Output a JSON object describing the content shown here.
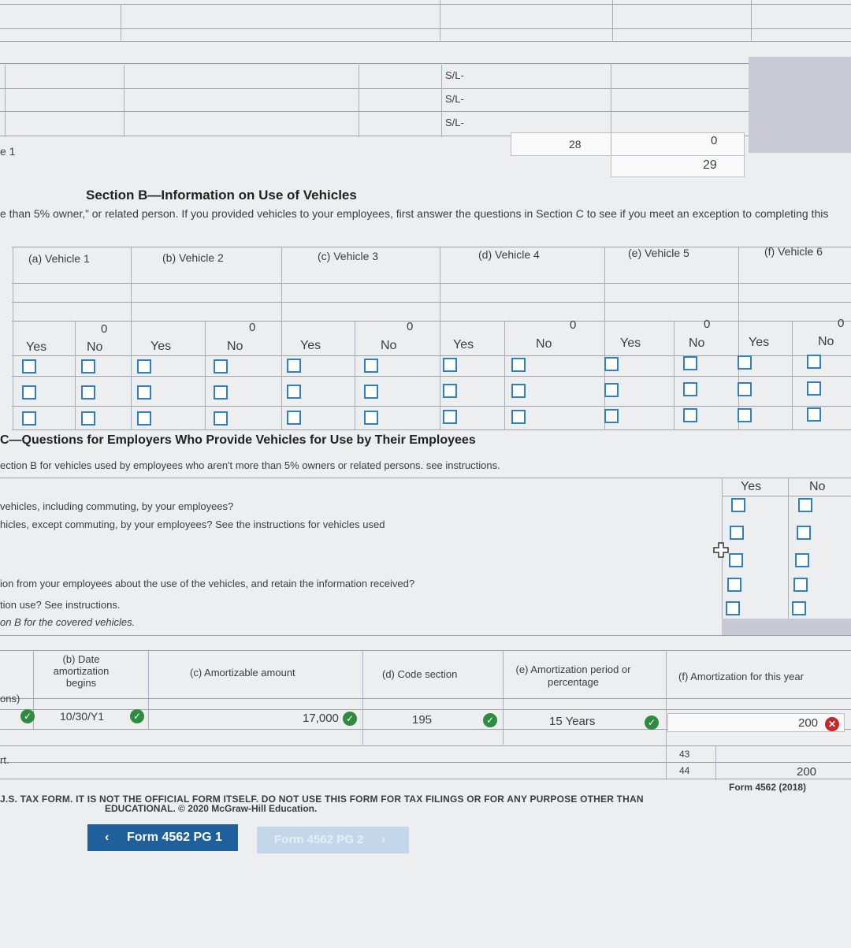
{
  "top_table": {
    "sl_labels": [
      "S/L-",
      "S/L-",
      "S/L-"
    ],
    "line_label": "e 1",
    "box28": "28",
    "box28_value": "0",
    "box29": "29"
  },
  "section_b": {
    "title": "Section B—Information on Use of Vehicles",
    "intro": "e than 5% owner,” or related person.  If you provided vehicles to your employees, first answer the questions in Section C to see if you meet an exception to completing this",
    "vehicles": [
      "(a) Vehicle 1",
      "(b) Vehicle 2",
      "(c) Vehicle 3",
      "(d) Vehicle 4",
      "(e) Vehicle 5",
      "(f) Vehicle 6"
    ],
    "totals": [
      "0",
      "0",
      "0",
      "0",
      "0",
      "0"
    ],
    "yes_label": "Yes",
    "no_label": "No"
  },
  "section_c": {
    "title": "C—Questions for Employers Who Provide Vehicles for Use by Their Employees",
    "intro": "ection B for vehicles used by employees who aren't more than 5% owners or related persons. see instructions.",
    "yes_label": "Yes",
    "no_label": "No",
    "questions": [
      "vehicles, including commuting, by your employees?",
      "hicles, except commuting, by your employees?  See the instructions for vehicles used",
      "ion from your employees about the use of the vehicles, and retain the information received?",
      "tion use?  See instructions.",
      "on B for the covered vehicles."
    ]
  },
  "amortization": {
    "col_b": "(b) Date amortization begins",
    "col_c": "(c) Amortizable amount",
    "col_d": "(d) Code section",
    "col_e": "(e) Amortization period or percentage",
    "col_f": "(f) Amortization for this year",
    "left_stub": "ons)",
    "row": {
      "date": "10/30/Y1",
      "amount": "17,000",
      "code": "195",
      "period": "15 Years",
      "amort": "200"
    },
    "stub2": "rt.",
    "line43": "43",
    "line44": "44",
    "total44": "200",
    "form_label": "Form 4562 (2018)"
  },
  "disclaimer_1": "J.S. TAX FORM. IT IS NOT THE OFFICIAL FORM ITSELF. DO NOT USE THIS FORM FOR TAX FILINGS OR FOR ANY PURPOSE OTHER THAN",
  "disclaimer_2": "EDUCATIONAL. © 2020 McGraw-Hill Education.",
  "nav": {
    "prev": "Form 4562 PG 1",
    "next": "Form 4562 PG 2"
  },
  "colors": {
    "checkbox": "#2f7fc1",
    "check": "#2e8b3f",
    "error": "#c8262c",
    "button": "#1f5f9c"
  }
}
